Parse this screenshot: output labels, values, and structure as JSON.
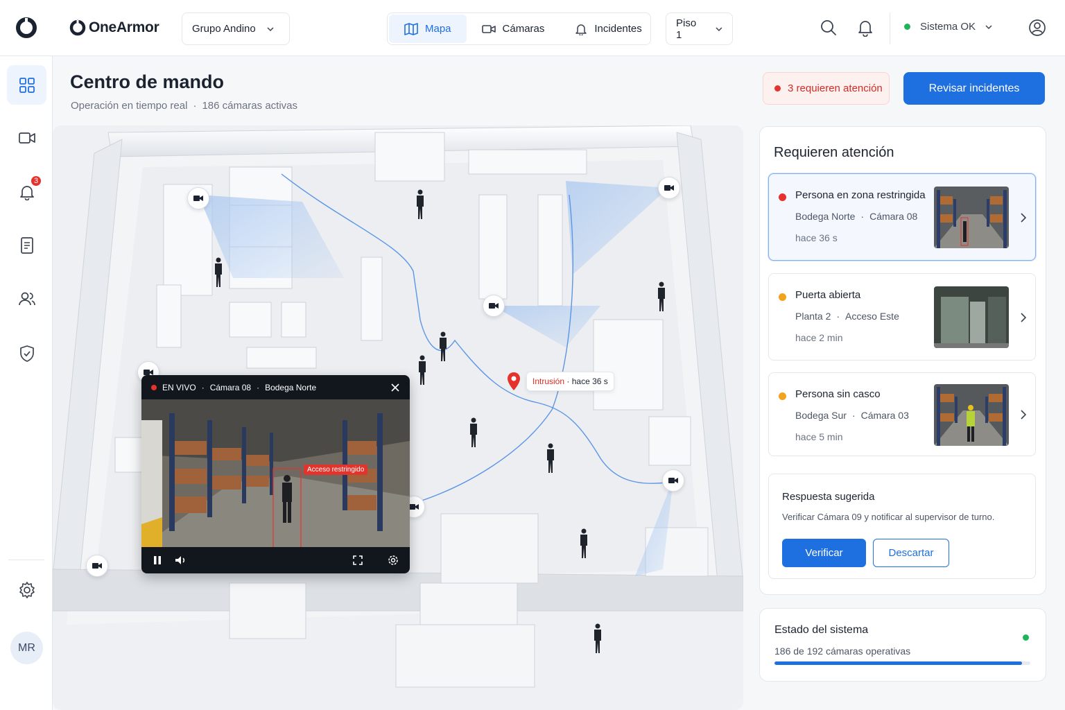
{
  "brand": {
    "name": "OneArmor"
  },
  "org_select": {
    "value": "Grupo Andino"
  },
  "nav": {
    "tabs": [
      {
        "label": "Mapa",
        "icon": "map-icon",
        "active": true
      },
      {
        "label": "Cámaras",
        "icon": "video-camera-icon",
        "active": false
      },
      {
        "label": "Incidentes",
        "icon": "bell-icon",
        "active": false
      }
    ]
  },
  "floor_select": {
    "value": "Piso 1"
  },
  "system_status": {
    "label": "Sistema OK",
    "color": "#1fb45a"
  },
  "sidebar": {
    "items": [
      {
        "name": "dashboard",
        "icon": "grid-icon",
        "active": true
      },
      {
        "name": "cameras",
        "icon": "video-camera-icon"
      },
      {
        "name": "alerts",
        "icon": "bell-icon",
        "badge": "3"
      },
      {
        "name": "reports",
        "icon": "document-icon"
      },
      {
        "name": "users",
        "icon": "users-icon"
      },
      {
        "name": "security",
        "icon": "shield-check-icon"
      },
      {
        "name": "settings",
        "icon": "gear-icon"
      }
    ],
    "avatar": "MR"
  },
  "header": {
    "title": "Centro de mando",
    "subtitle_part1": "Operación en tiempo real",
    "separator": "·",
    "subtitle_part2": "186 cámaras activas",
    "alert_chip": "3 requieren atención",
    "primary_button": "Revisar incidentes"
  },
  "map": {
    "intrusion_label": "Intrusión",
    "intrusion_time": "hace 36 s",
    "separator": "·",
    "live": {
      "status": "EN VIVO",
      "camera": "Cámara 08",
      "location": "Bodega Norte",
      "detection_label": "Acceso restringido"
    }
  },
  "panel": {
    "title": "Requieren atención",
    "separator": "·",
    "incidents": [
      {
        "title": "Persona en zona restringida",
        "place": "Bodega Norte",
        "detail": "Cámara 08",
        "time": "hace 36 s",
        "severity_color": "#e5322d",
        "selected": true
      },
      {
        "title": "Puerta abierta",
        "place": "Planta 2",
        "detail": "Acceso Este",
        "time": "hace 2 min",
        "severity_color": "#f3a21c",
        "selected": false
      },
      {
        "title": "Persona sin casco",
        "place": "Bodega Sur",
        "detail": "Cámara 03",
        "time": "hace 5 min",
        "severity_color": "#f3a21c",
        "selected": false
      }
    ],
    "suggestion": {
      "title": "Respuesta sugerida",
      "text": "Verificar Cámara 09 y notificar al supervisor de turno.",
      "verify": "Verificar",
      "discard": "Descartar"
    }
  },
  "system": {
    "title": "Estado del sistema",
    "text": "186 de 192 cámaras operativas",
    "operational": 186,
    "total": 192,
    "status_color": "#1fb45a"
  },
  "colors": {
    "accent": "#1e6fe0",
    "danger": "#e5322d",
    "warning": "#f3a21c",
    "ok": "#1fb45a"
  }
}
